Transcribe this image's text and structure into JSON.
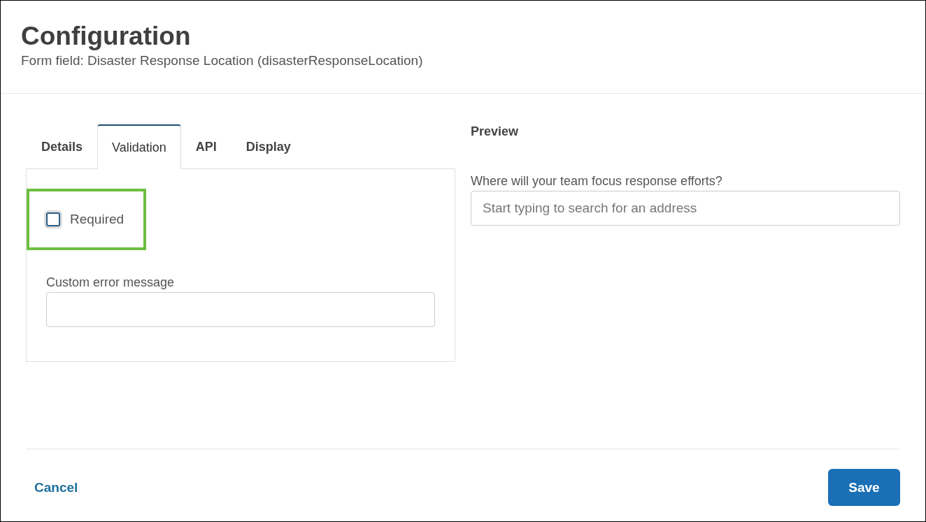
{
  "header": {
    "title": "Configuration",
    "subtitle": "Form field: Disaster Response Location (disasterResponseLocation)"
  },
  "tabs": [
    {
      "label": "Details",
      "selected": false
    },
    {
      "label": "Validation",
      "selected": true
    },
    {
      "label": "API",
      "selected": false
    },
    {
      "label": "Display",
      "selected": false
    }
  ],
  "validation": {
    "required": {
      "label": "Required",
      "checked": false,
      "highlighted": true
    },
    "error_message": {
      "label": "Custom error message"
    }
  },
  "preview": {
    "title": "Preview",
    "question": "Where will your team focus response efforts?",
    "placeholder": "Start typing to search for an address"
  },
  "footer": {
    "cancel": "Cancel",
    "save": "Save"
  }
}
